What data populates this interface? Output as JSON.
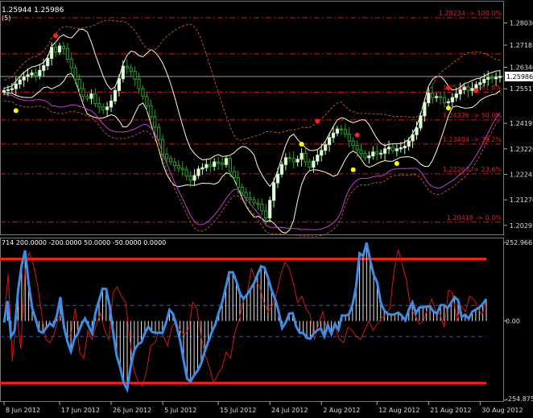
{
  "chart_data": [
    {
      "type": "candlestick",
      "header_text": "1.25944 1.25986",
      "header_suffix": "(5)",
      "price_scale": {
        "ylim": [
          1.1995,
          1.2888
        ],
        "ticks": [
          "1.28030",
          "1.27185",
          "1.26340",
          "1.25517",
          "1.24195",
          "1.23220",
          "1.22245",
          "1.21270",
          "1.20295"
        ],
        "tick_values": [
          1.2803,
          1.27185,
          1.2634,
          1.25517,
          1.24195,
          1.2322,
          1.22245,
          1.2127,
          1.20295
        ],
        "current_price_label": "1.25986",
        "current_price": 1.25986
      },
      "fibonacci_levels": [
        {
          "label": "1.28234 -> 100.0%",
          "value": 1.28234
        },
        {
          "label": "1.25388 -> 61.8%",
          "value": 1.25388
        },
        {
          "label": "1.24326 -> 50.0%",
          "value": 1.24326
        },
        {
          "label": "1.23404 -> 38.2%",
          "value": 1.23404
        },
        {
          "label": "1.22263 -> 23.6%",
          "value": 1.22263
        },
        {
          "label": "1.20418 -> 0.0%",
          "value": 1.20418
        }
      ],
      "extra_dashed_levels": [
        1.2685
      ],
      "time_axis": {
        "labels": [
          "8 Jun 2012",
          "17 Jun 2012",
          "26 Jun 2012",
          "5 Jul 2012",
          "15 Jul 2012",
          "24 Jul 2012",
          "2 Aug 2012",
          "12 Aug 2012",
          "21 Aug 2012",
          "30 Aug 2012"
        ],
        "label_index": [
          0,
          14,
          27,
          40,
          54,
          67,
          80,
          94,
          107,
          120
        ]
      },
      "candles_close": [
        1.2545,
        1.2548,
        1.2552,
        1.257,
        1.2585,
        1.2598,
        1.2605,
        1.2612,
        1.2602,
        1.2622,
        1.264,
        1.2668,
        1.271,
        1.2692,
        1.2715,
        1.2705,
        1.2665,
        1.2632,
        1.2588,
        1.2552,
        1.2522,
        1.2515,
        1.2532,
        1.2495,
        1.2482,
        1.2472,
        1.2482,
        1.2505,
        1.2545,
        1.259,
        1.2638,
        1.2632,
        1.2618,
        1.2588,
        1.2552,
        1.2522,
        1.2487,
        1.2445,
        1.2405,
        1.2358,
        1.2302,
        1.2285,
        1.2272,
        1.2258,
        1.2248,
        1.2242,
        1.2218,
        1.2202,
        1.222,
        1.2245,
        1.225,
        1.2262,
        1.2255,
        1.2272,
        1.2268,
        1.2262,
        1.2285,
        1.2235,
        1.2212,
        1.2175,
        1.2155,
        1.2135,
        1.2128,
        1.2115,
        1.211,
        1.2085,
        1.2058,
        1.2125,
        1.2192,
        1.2225,
        1.2262,
        1.2288,
        1.2285,
        1.2272,
        1.2282,
        1.2305,
        1.2272,
        1.2252,
        1.2275,
        1.2298,
        1.2316,
        1.2338,
        1.2365,
        1.2382,
        1.2398,
        1.2396,
        1.2378,
        1.2352,
        1.2335,
        1.2318,
        1.2305,
        1.2288,
        1.2295,
        1.231,
        1.2302,
        1.2305,
        1.2322,
        1.2328,
        1.2315,
        1.2322,
        1.2326,
        1.2332,
        1.2352,
        1.2376,
        1.2402,
        1.2448,
        1.2498,
        1.2535,
        1.2518,
        1.2522,
        1.2518,
        1.2498,
        1.2502,
        1.2518,
        1.2532,
        1.2548,
        1.2558,
        1.2545,
        1.2553,
        1.2568,
        1.2575,
        1.2588,
        1.2594,
        1.259,
        1.2595,
        1.2599
      ],
      "indicator_points": [
        {
          "color": "#ff2020",
          "i": 13,
          "value": 1.2755
        },
        {
          "color": "#ff2020",
          "i": 79,
          "value": 1.2428
        },
        {
          "color": "#ff2020",
          "i": 89,
          "value": 1.2375
        },
        {
          "color": "#ff2020",
          "i": 112,
          "value": 1.2555
        },
        {
          "color": "#ff2020",
          "i": 119,
          "value": 1.2545
        },
        {
          "color": "#ffff00",
          "i": 3,
          "value": 1.2468
        },
        {
          "color": "#ffff00",
          "i": 75,
          "value": 1.234
        },
        {
          "color": "#ffff00",
          "i": 88,
          "value": 1.2242
        },
        {
          "color": "#ffff00",
          "i": 99,
          "value": 1.2266
        },
        {
          "color": "#ffff00",
          "i": 112,
          "value": 1.2478
        }
      ],
      "colors": {
        "bull": "#c8f7c5",
        "bear": "#2aa02a",
        "fib": "#d01818",
        "current": "#9a9a9a",
        "grid": "#606060"
      }
    },
    {
      "type": "line",
      "header_text": "714 200.0000 -200.0000 50.0000 -50.0000 0.0000",
      "y_ticks": [
        "252.966",
        "0.00",
        "-254.875"
      ],
      "y_tick_values": [
        252.966,
        0,
        -254.875
      ],
      "ylim": [
        -258,
        266
      ],
      "levels": {
        "upper": 200,
        "lower": -200,
        "upper_mid": 50,
        "lower_mid": -50,
        "zero": 0
      },
      "cci_values": [
        -5,
        64,
        -50,
        -32,
        99,
        180,
        227,
        120,
        42,
        5,
        -33,
        -38,
        -22,
        -8,
        -17,
        17,
        77,
        -18,
        -66,
        -98,
        -58,
        -40,
        -11,
        8,
        -15,
        -39,
        28,
        66,
        104,
        103,
        48,
        -35,
        -112,
        -150,
        -200,
        -220,
        -145,
        -95,
        -76,
        -69,
        -39,
        -18,
        -35,
        -38,
        -38,
        -38,
        -7,
        36,
        23,
        -16,
        -62,
        -126,
        -186,
        -195,
        -175,
        -160,
        -137,
        -99,
        -67,
        -36,
        -12,
        27,
        61,
        109,
        157,
        157,
        127,
        89,
        72,
        84,
        103,
        121,
        149,
        176,
        172,
        139,
        100,
        71,
        31,
        -23,
        -5,
        24,
        25,
        -18,
        -38,
        -38,
        -55,
        -57,
        -39,
        -30,
        -24,
        -50,
        -13,
        -42,
        -9,
        -28,
        18,
        17,
        22,
        53,
        109,
        218,
        209,
        252,
        197,
        149,
        124,
        60,
        34,
        23,
        20,
        22,
        27,
        17,
        2,
        37,
        60,
        25,
        44,
        44,
        47,
        47,
        30,
        24,
        51,
        51,
        41,
        59,
        77,
        67,
        13,
        20,
        7,
        30,
        37,
        43,
        55,
        71
      ],
      "signal_values": [
        5,
        150,
        -130,
        30,
        -90,
        160,
        220,
        180,
        115,
        20,
        -60,
        -70,
        -40,
        10,
        30,
        -60,
        -40,
        40,
        -100,
        -120,
        -30,
        -60,
        -10,
        25,
        -30,
        -60,
        90,
        110,
        80,
        60,
        -60,
        -160,
        -195,
        -210,
        -160,
        -80,
        -70,
        -30,
        -50,
        -80,
        -20,
        0,
        -30,
        -45,
        -25,
        60,
        40,
        -50,
        -110,
        -150,
        -200,
        -170,
        -150,
        -100,
        -120,
        -40,
        0,
        60,
        90,
        170,
        130,
        110,
        60,
        30,
        50,
        90,
        150,
        190,
        170,
        120,
        60,
        80,
        40,
        20,
        -60,
        -10,
        30,
        -30,
        -40,
        -20,
        -60,
        -70,
        -20,
        -30,
        -50,
        -60,
        -30,
        0,
        -30,
        -10,
        10,
        20,
        40,
        160,
        230,
        180,
        130,
        40,
        20,
        -10,
        0,
        40,
        70,
        30,
        20,
        -20,
        100,
        90,
        0,
        50,
        30,
        80,
        70,
        40,
        20,
        70
      ],
      "colors": {
        "cci": "#3a8ee6",
        "signal": "#d01818",
        "level": "#ff1a1a",
        "mid": "#3a4ee0",
        "bars": "#e0e0e0"
      }
    }
  ]
}
